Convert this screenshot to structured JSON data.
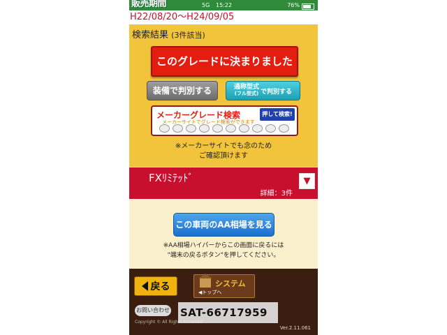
{
  "status_bar": {
    "title": "販売期間",
    "signal": "5G",
    "time": "15:22",
    "battery": "76%"
  },
  "period": "H22/08/20～H24/09/05",
  "results": {
    "label": "検索結果",
    "count": "(3件該当)"
  },
  "buttons": {
    "decide": "このグレードに決まりました",
    "equipment": "装備で判別する",
    "model_a": "通称型式",
    "model_b": "(フル型式)",
    "model_c": "で判別する",
    "maker_title": "メーカーグレード検索",
    "maker_sub": "メーカーサイトでグレード検索ができます",
    "maker_push": "押して検索!"
  },
  "note_lines": [
    "※メーカーサイトでも念のため",
    "ご確認頂けます"
  ],
  "grade": {
    "name": "FXﾘﾐﾃｯﾄﾞ",
    "detail": "詳細：3件",
    "dropdown": "▼"
  },
  "aa": {
    "button": "この車両のAA相場を見る",
    "note_lines": [
      "※AA相場ハイパーからこの画面に戻るには",
      "\"端末の戻るボタン\"を押してください。"
    ]
  },
  "footer": {
    "back": "戻る",
    "logo": "システム",
    "top": "◀トップへ",
    "contact": "お問い合わせ",
    "copyright": "Copyright © All Rights Reserved",
    "version": "Ver.2.11.061"
  },
  "stock_no": "SAT-66717959"
}
